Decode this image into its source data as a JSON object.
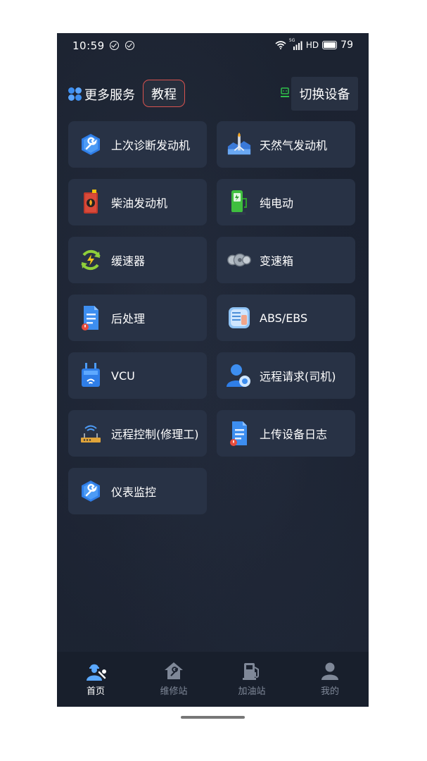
{
  "status_bar": {
    "time": "10:59",
    "network": "5G",
    "hd": "HD",
    "battery": "79"
  },
  "header": {
    "more_services": "更多服务",
    "tutorial": "教程",
    "switch_device": "切换设备"
  },
  "menu": [
    {
      "label": "上次诊断发动机",
      "icon": "wrench-icon"
    },
    {
      "label": "天然气发动机",
      "icon": "gas-engine-icon"
    },
    {
      "label": "柴油发动机",
      "icon": "diesel-can-icon"
    },
    {
      "label": "纯电动",
      "icon": "ev-charger-icon"
    },
    {
      "label": "缓速器",
      "icon": "retarder-cycle-icon"
    },
    {
      "label": "变速箱",
      "icon": "gearbox-icon"
    },
    {
      "label": "后处理",
      "icon": "document-alert-icon"
    },
    {
      "label": "ABS/EBS",
      "icon": "abs-module-icon"
    },
    {
      "label": "VCU",
      "icon": "vcu-router-icon"
    },
    {
      "label": "远程请求(司机)",
      "icon": "driver-user-icon"
    },
    {
      "label": "远程控制(修理工)",
      "icon": "wifi-router-icon"
    },
    {
      "label": "上传设备日志",
      "icon": "upload-log-icon"
    },
    {
      "label": "仪表监控",
      "icon": "wrench-icon"
    }
  ],
  "tabs": [
    {
      "label": "首页",
      "icon": "mechanic-icon",
      "active": true
    },
    {
      "label": "维修站",
      "icon": "repair-station-icon",
      "active": false
    },
    {
      "label": "加油站",
      "icon": "fuel-pump-icon",
      "active": false
    },
    {
      "label": "我的",
      "icon": "profile-icon",
      "active": false
    }
  ],
  "colors": {
    "background": "#1b2230",
    "card": "#283245",
    "accent_blue": "#3d8ef0",
    "tutorial_border": "#d9534f",
    "tab_inactive": "#7f8898"
  }
}
